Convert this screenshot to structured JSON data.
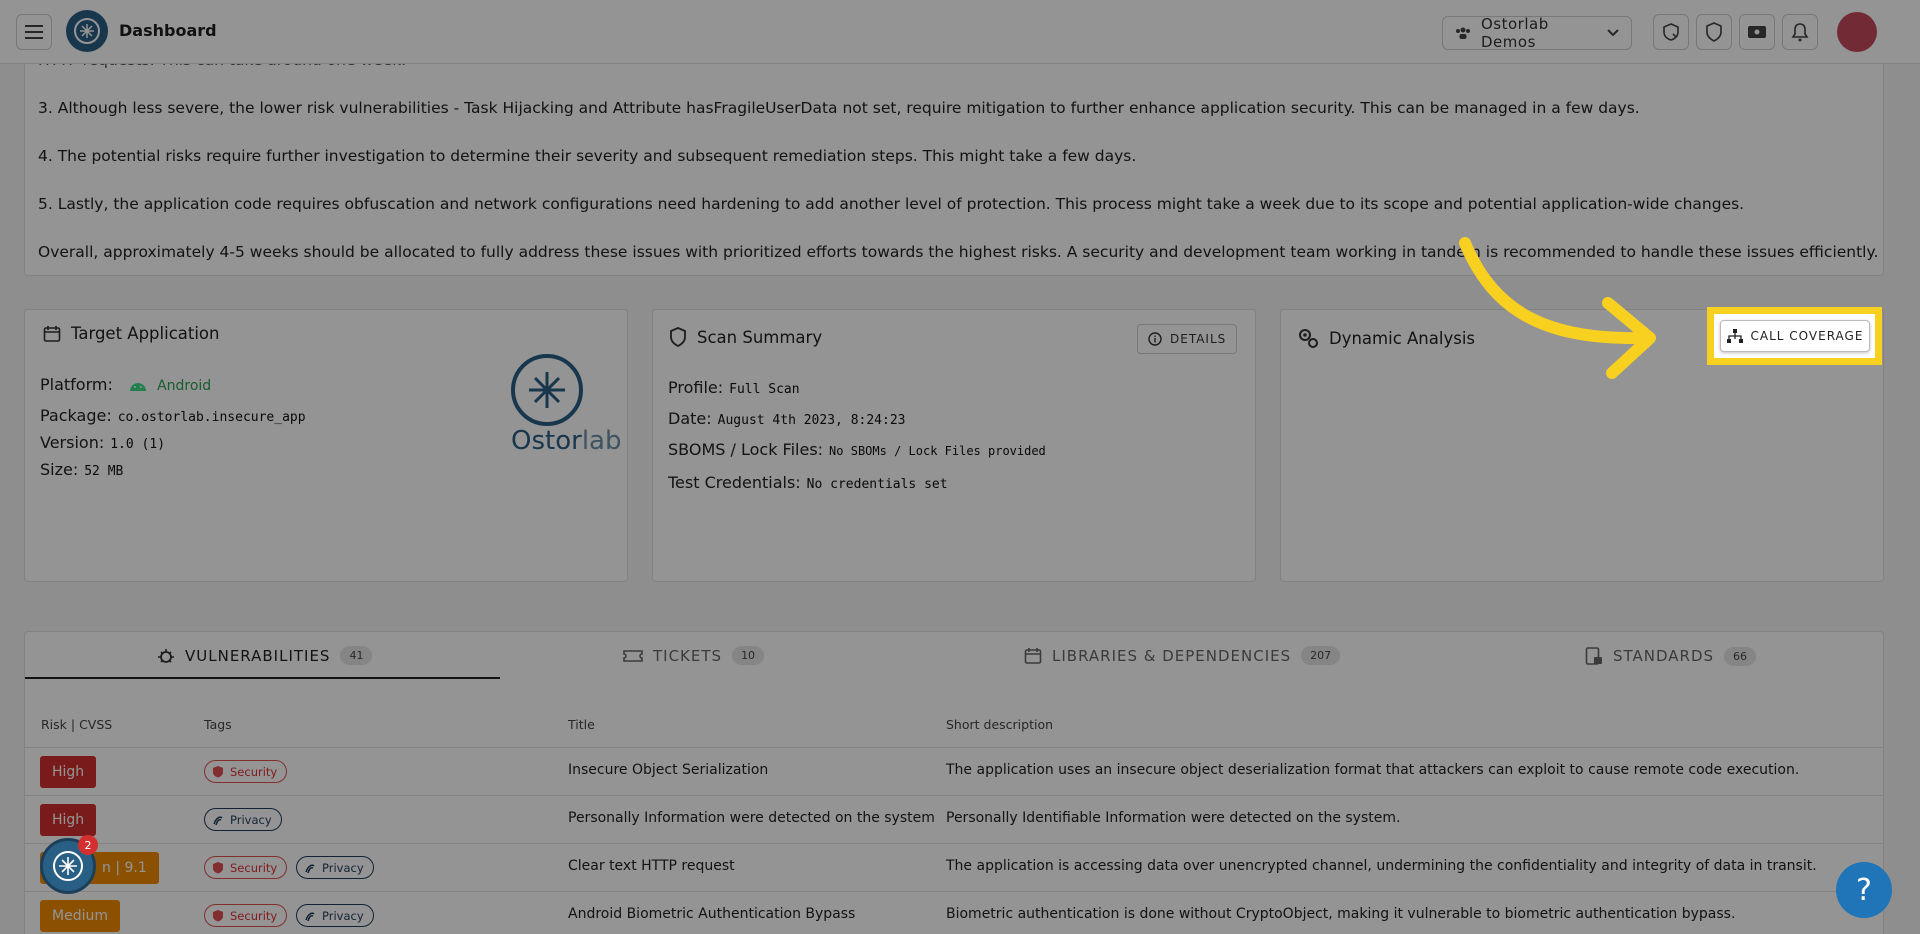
{
  "header": {
    "title": "Dashboard",
    "org_label": "Ostorlab Demos",
    "icons": [
      "menu-icon",
      "refresh-shield-icon",
      "shield-icon",
      "ticket-icon",
      "bell-icon"
    ]
  },
  "report": {
    "partial_line": "HTTP requests. This can take around one week.",
    "paragraphs": [
      "3. Although less severe, the lower risk vulnerabilities - Task Hijacking and Attribute hasFragileUserData not set, require mitigation to further enhance application security. This can be managed in a few days.",
      "4. The potential risks require further investigation to determine their severity and subsequent remediation steps. This might take a few days.",
      "5. Lastly, the application code requires obfuscation and network configurations need hardening to add another level of protection. This process might take a week due to its scope and potential application-wide changes.",
      "Overall, approximately 4-5 weeks should be allocated to fully address these issues with prioritized efforts towards the highest risks. A security and development team working in tandem is recommended to handle these issues efficiently."
    ]
  },
  "target_app": {
    "title": "Target Application",
    "platform_label": "Platform:",
    "platform_value": "Android",
    "package_label": "Package:",
    "package_value": "co.ostorlab.insecure_app",
    "version_label": "Version:",
    "version_value": "1.0 (1)",
    "size_label": "Size:",
    "size_value": "52 MB",
    "logo_text_a": "Ostor",
    "logo_text_b": "lab"
  },
  "scan_summary": {
    "title": "Scan Summary",
    "details_label": "DETAILS",
    "profile_label": "Profile:",
    "profile_value": "Full Scan",
    "date_label": "Date:",
    "date_value": "August 4th 2023, 8:24:23",
    "sboms_label": "SBOMS / Lock Files:",
    "sboms_value": "No SBOMs / Lock Files provided",
    "creds_label": "Test Credentials:",
    "creds_value": "No credentials set"
  },
  "dynamic": {
    "title": "Dynamic Analysis",
    "call_coverage_label": "CALL COVERAGE"
  },
  "tabs": [
    {
      "label": "VULNERABILITIES",
      "count": "41"
    },
    {
      "label": "TICKETS",
      "count": "10"
    },
    {
      "label": "LIBRARIES & DEPENDENCIES",
      "count": "207"
    },
    {
      "label": "STANDARDS",
      "count": "66"
    }
  ],
  "table": {
    "headers": [
      "Risk | CVSS",
      "Tags",
      "Title",
      "Short description"
    ],
    "rows": [
      {
        "risk": "High",
        "tags": [
          "Security"
        ],
        "title": "Insecure Object Serialization",
        "desc": "The application uses an insecure object deserialization format that attackers can exploit to cause remote code execution."
      },
      {
        "risk": "High",
        "tags": [
          "Privacy"
        ],
        "title": "Personally Information were detected on the system",
        "desc": "Personally Identifiable Information were detected on the system."
      },
      {
        "risk": "n | 9.1",
        "tags": [
          "Security",
          "Privacy"
        ],
        "title": "Clear text HTTP request",
        "desc": "The application is accessing data over unencrypted channel, undermining the confidentiality and integrity of data in transit."
      },
      {
        "risk": "Medium",
        "tags": [
          "Security",
          "Privacy"
        ],
        "title": "Android Biometric Authentication Bypass",
        "desc": "Biometric authentication is done without CryptoObject, making it vulnerable to biometric authentication bypass."
      }
    ]
  },
  "fab": {
    "badge": "2",
    "help": "?"
  },
  "colors": {
    "accent": "#f7d020",
    "high": "#d32f2f",
    "medium": "#f08c00",
    "android": "#3ddc84"
  }
}
